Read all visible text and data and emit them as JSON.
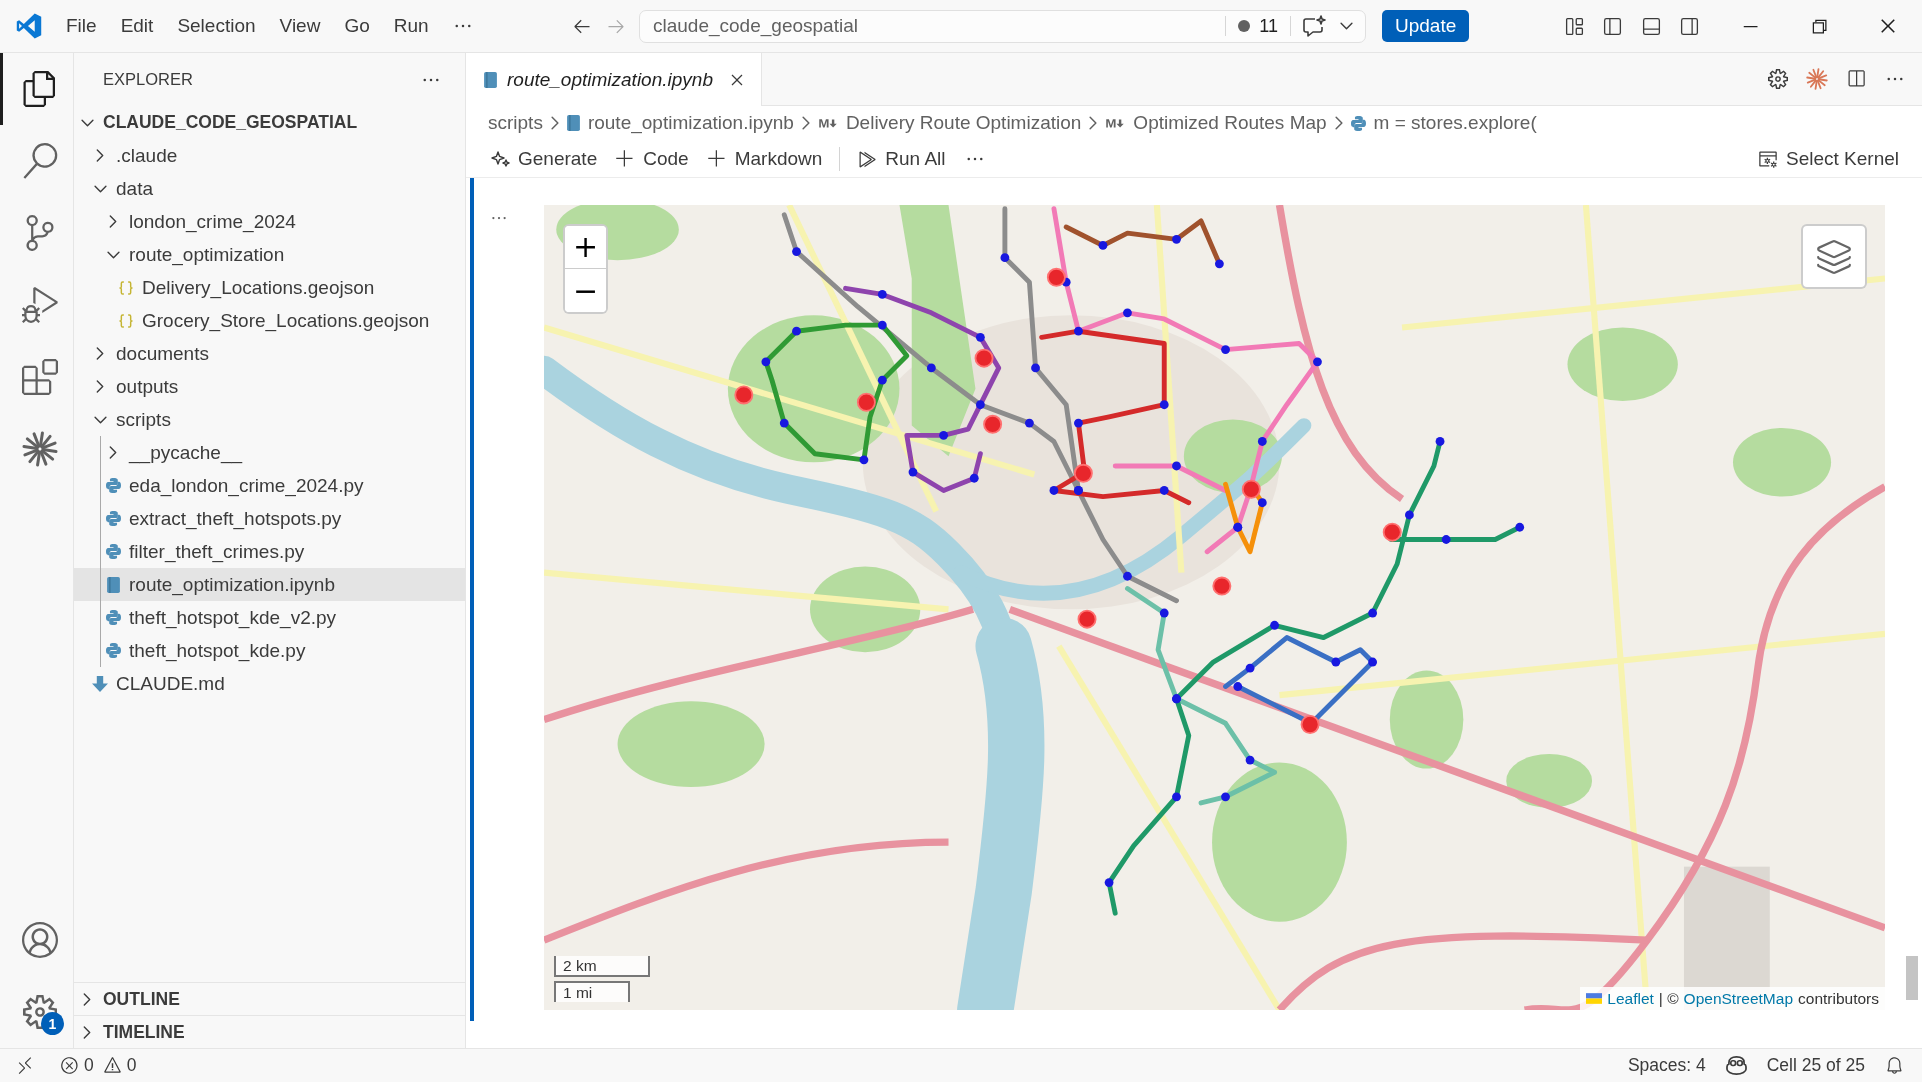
{
  "title_bar": {
    "menu": [
      {
        "label": "File"
      },
      {
        "label": "Edit"
      },
      {
        "label": "Selection"
      },
      {
        "label": "View"
      },
      {
        "label": "Go"
      },
      {
        "label": "Run"
      }
    ],
    "nav": [
      {
        "kind": "back",
        "disabled": false
      },
      {
        "kind": "forward",
        "disabled": true
      }
    ],
    "search": {
      "value": "claude_code_geospatial"
    },
    "notification_count": "11",
    "update_button": "Update"
  },
  "activity_bar": {
    "items": [
      {
        "kind": "explorer",
        "selected": true
      },
      {
        "kind": "search",
        "selected": false
      },
      {
        "kind": "source_control",
        "selected": false
      },
      {
        "kind": "run_debug",
        "selected": false
      },
      {
        "kind": "extensions",
        "selected": false
      },
      {
        "kind": "claude",
        "selected": false
      }
    ],
    "settings_badge": "1"
  },
  "sidebar": {
    "title": "EXPLORER",
    "root": {
      "label": "CLAUDE_CODE_GEOSPATIAL",
      "expanded": true
    },
    "tree": [
      {
        "label": ".claude",
        "kind": "folder",
        "expanded": false,
        "selected": false
      },
      {
        "label": "data",
        "kind": "folder",
        "expanded": true,
        "selected": false,
        "children": [
          {
            "label": "london_crime_2024",
            "kind": "folder",
            "expanded": false,
            "selected": false
          },
          {
            "label": "route_optimization",
            "kind": "folder",
            "expanded": true,
            "selected": false,
            "children": [
              {
                "label": "Delivery_Locations.geojson",
                "kind": "json",
                "selected": false
              },
              {
                "label": "Grocery_Store_Locations.geojson",
                "kind": "json",
                "selected": false
              }
            ]
          }
        ]
      },
      {
        "label": "documents",
        "kind": "folder",
        "expanded": false,
        "selected": false
      },
      {
        "label": "outputs",
        "kind": "folder",
        "expanded": false,
        "selected": false
      },
      {
        "label": "scripts",
        "kind": "folder",
        "expanded": true,
        "selected": false,
        "children": [
          {
            "label": "__pycache__",
            "kind": "folder",
            "expanded": false,
            "selected": false
          },
          {
            "label": "eda_london_crime_2024.py",
            "kind": "python",
            "selected": false
          },
          {
            "label": "extract_theft_hotspots.py",
            "kind": "python",
            "selected": false
          },
          {
            "label": "filter_theft_crimes.py",
            "kind": "python",
            "selected": false
          },
          {
            "label": "route_optimization.ipynb",
            "kind": "notebook",
            "selected": true
          },
          {
            "label": "theft_hotspot_kde_v2.py",
            "kind": "python",
            "selected": false
          },
          {
            "label": "theft_hotspot_kde.py",
            "kind": "python",
            "selected": false
          }
        ]
      },
      {
        "label": "CLAUDE.md",
        "kind": "markdown",
        "selected": false
      }
    ],
    "panels": [
      {
        "label": "OUTLINE",
        "expanded": false
      },
      {
        "label": "TIMELINE",
        "expanded": false
      }
    ]
  },
  "editor": {
    "tabs": [
      {
        "label": "route_optimization.ipynb",
        "selected": true
      }
    ],
    "breadcrumbs": [
      {
        "label": "scripts",
        "kind": "folder"
      },
      {
        "label": "route_optimization.ipynb",
        "kind": "notebook"
      },
      {
        "label": "Delivery Route Optimization",
        "kind": "markdown"
      },
      {
        "label": "Optimized Routes Map",
        "kind": "markdown"
      },
      {
        "label": "m = stores.explore(",
        "kind": "code"
      }
    ],
    "toolbar": [
      {
        "kind": "generate",
        "label": "Generate"
      },
      {
        "kind": "add",
        "label": "Code"
      },
      {
        "kind": "add",
        "label": "Markdown"
      },
      {
        "kind": "run_all",
        "label": "Run All"
      }
    ],
    "kernel": "Select Kernel",
    "map": {
      "zoom_in": "+",
      "zoom_out": "−",
      "scale": [
        {
          "label": "2 km"
        },
        {
          "label": "1 mi"
        }
      ],
      "attribution": [
        {
          "kind": "link",
          "text": "Leaflet"
        },
        {
          "kind": "text",
          "text": "| ©"
        },
        {
          "kind": "link",
          "text": "OpenStreetMap"
        },
        {
          "kind": "text",
          "text": "contributors"
        }
      ]
    }
  },
  "status_bar": {
    "errors": "0",
    "warnings": "0",
    "indentation": "Spaces: 4",
    "cell": "Cell 25 of 25"
  }
}
